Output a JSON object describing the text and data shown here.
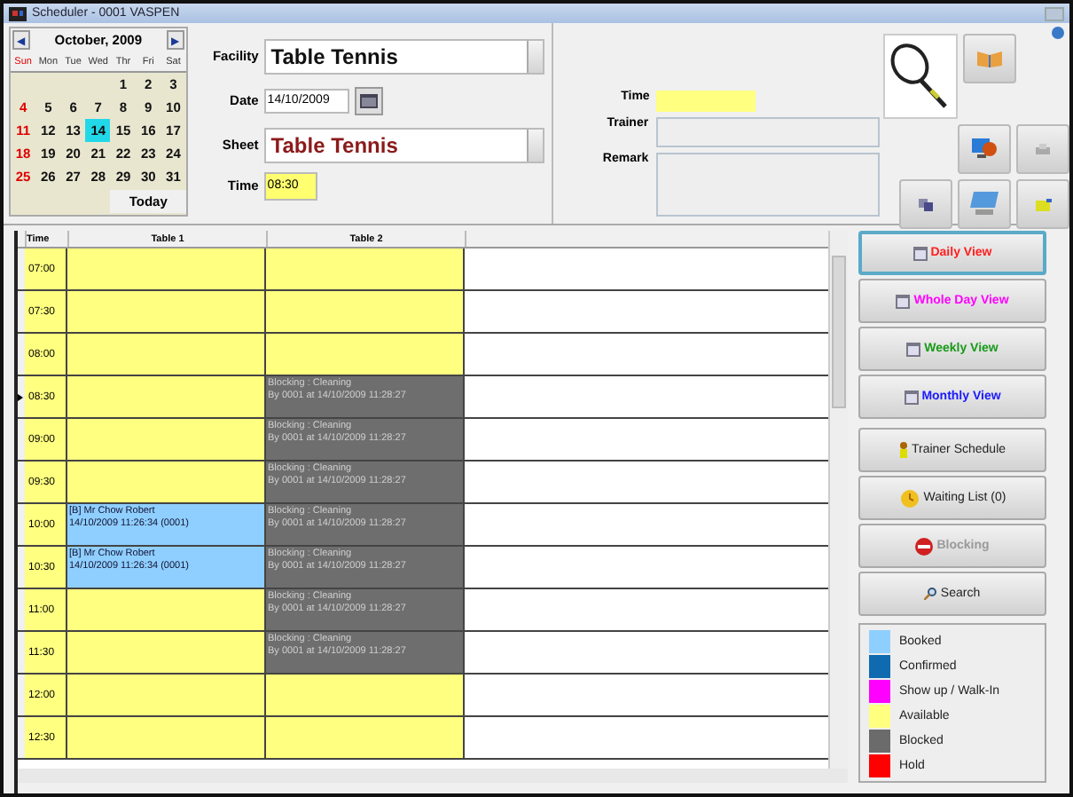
{
  "window": {
    "title": "Scheduler - 0001 VASPEN"
  },
  "calendar": {
    "month": "October, 2009",
    "prev": "◀",
    "next": "▶",
    "weekdays": [
      "Sun",
      "Mon",
      "Tue",
      "Wed",
      "Thr",
      "Fri",
      "Sat"
    ],
    "weeks": [
      [
        {
          "kind": "blank"
        },
        {
          "kind": "blank"
        },
        {
          "kind": "blank"
        },
        {
          "kind": "blank"
        },
        {
          "kind": "day",
          "day": "1",
          "selected": false
        },
        {
          "kind": "day",
          "day": "2",
          "selected": false
        },
        {
          "kind": "day",
          "day": "3",
          "selected": false
        }
      ],
      [
        {
          "kind": "day",
          "day": "4",
          "selected": false
        },
        {
          "kind": "day",
          "day": "5",
          "selected": false
        },
        {
          "kind": "day",
          "day": "6",
          "selected": false
        },
        {
          "kind": "day",
          "day": "7",
          "selected": false
        },
        {
          "kind": "day",
          "day": "8",
          "selected": false
        },
        {
          "kind": "day",
          "day": "9",
          "selected": false
        },
        {
          "kind": "day",
          "day": "10",
          "selected": false
        }
      ],
      [
        {
          "kind": "day",
          "day": "11",
          "selected": false
        },
        {
          "kind": "day",
          "day": "12",
          "selected": false
        },
        {
          "kind": "day",
          "day": "13",
          "selected": false
        },
        {
          "kind": "day",
          "day": "14",
          "selected": true
        },
        {
          "kind": "day",
          "day": "15",
          "selected": false
        },
        {
          "kind": "day",
          "day": "16",
          "selected": false
        },
        {
          "kind": "day",
          "day": "17",
          "selected": false
        }
      ],
      [
        {
          "kind": "day",
          "day": "18",
          "selected": false
        },
        {
          "kind": "day",
          "day": "19",
          "selected": false
        },
        {
          "kind": "day",
          "day": "20",
          "selected": false
        },
        {
          "kind": "day",
          "day": "21",
          "selected": false
        },
        {
          "kind": "day",
          "day": "22",
          "selected": false
        },
        {
          "kind": "day",
          "day": "23",
          "selected": false
        },
        {
          "kind": "day",
          "day": "24",
          "selected": false
        }
      ],
      [
        {
          "kind": "day",
          "day": "25",
          "selected": false
        },
        {
          "kind": "day",
          "day": "26",
          "selected": false
        },
        {
          "kind": "day",
          "day": "27",
          "selected": false
        },
        {
          "kind": "day",
          "day": "28",
          "selected": false
        },
        {
          "kind": "day",
          "day": "29",
          "selected": false
        },
        {
          "kind": "day",
          "day": "30",
          "selected": false
        },
        {
          "kind": "day",
          "day": "31",
          "selected": false
        }
      ]
    ],
    "today": "Today"
  },
  "form": {
    "facility_label": "Facility",
    "facility": "Table Tennis",
    "date_label": "Date",
    "date": "14/10/2009",
    "sheet_label": "Sheet",
    "sheet": "Table Tennis",
    "time_label": "Time",
    "time": "08:30"
  },
  "details": {
    "time_label": "Time",
    "trainer_label": "Trainer",
    "remark_label": "Remark"
  },
  "grid": {
    "columns": [
      "Time",
      "Table 1",
      "Table 2"
    ],
    "rows": [
      {
        "current": false,
        "cells": [
          {
            "kind": "time",
            "text": "07:00"
          },
          {
            "kind": "available"
          },
          {
            "kind": "available"
          }
        ]
      },
      {
        "current": false,
        "cells": [
          {
            "kind": "time",
            "text": "07:30"
          },
          {
            "kind": "available"
          },
          {
            "kind": "available"
          }
        ]
      },
      {
        "current": false,
        "cells": [
          {
            "kind": "time",
            "text": "08:00"
          },
          {
            "kind": "available"
          },
          {
            "kind": "available"
          }
        ]
      },
      {
        "current": true,
        "cells": [
          {
            "kind": "time",
            "text": "08:30"
          },
          {
            "kind": "available"
          },
          {
            "kind": "blocked",
            "lines": [
              "Blocking : Cleaning",
              "By 0001 at 14/10/2009 11:28:27"
            ]
          }
        ]
      },
      {
        "current": false,
        "cells": [
          {
            "kind": "time",
            "text": "09:00"
          },
          {
            "kind": "available"
          },
          {
            "kind": "blocked",
            "lines": [
              "Blocking : Cleaning",
              "By 0001 at 14/10/2009 11:28:27"
            ]
          }
        ]
      },
      {
        "current": false,
        "cells": [
          {
            "kind": "time",
            "text": "09:30"
          },
          {
            "kind": "available"
          },
          {
            "kind": "blocked",
            "lines": [
              "Blocking : Cleaning",
              "By 0001 at 14/10/2009 11:28:27"
            ]
          }
        ]
      },
      {
        "current": false,
        "cells": [
          {
            "kind": "time",
            "text": "10:00"
          },
          {
            "kind": "booked",
            "lines": [
              "[B] Mr Chow Robert",
              "14/10/2009 11:26:34 (0001)"
            ]
          },
          {
            "kind": "blocked",
            "lines": [
              "Blocking : Cleaning",
              "By 0001 at 14/10/2009 11:28:27"
            ]
          }
        ]
      },
      {
        "current": false,
        "cells": [
          {
            "kind": "time",
            "text": "10:30"
          },
          {
            "kind": "booked",
            "lines": [
              "[B] Mr Chow Robert",
              "14/10/2009 11:26:34 (0001)"
            ]
          },
          {
            "kind": "blocked",
            "lines": [
              "Blocking : Cleaning",
              "By 0001 at 14/10/2009 11:28:27"
            ]
          }
        ]
      },
      {
        "current": false,
        "cells": [
          {
            "kind": "time",
            "text": "11:00"
          },
          {
            "kind": "available"
          },
          {
            "kind": "blocked",
            "lines": [
              "Blocking : Cleaning",
              "By 0001 at 14/10/2009 11:28:27"
            ]
          }
        ]
      },
      {
        "current": false,
        "cells": [
          {
            "kind": "time",
            "text": "11:30"
          },
          {
            "kind": "available"
          },
          {
            "kind": "blocked",
            "lines": [
              "Blocking : Cleaning",
              "By 0001 at 14/10/2009 11:28:27"
            ]
          }
        ]
      },
      {
        "current": false,
        "cells": [
          {
            "kind": "time",
            "text": "12:00"
          },
          {
            "kind": "available"
          },
          {
            "kind": "available"
          }
        ]
      },
      {
        "current": false,
        "cells": [
          {
            "kind": "time",
            "text": "12:30"
          },
          {
            "kind": "available"
          },
          {
            "kind": "available"
          }
        ]
      }
    ]
  },
  "actions": [
    {
      "label": "Daily View",
      "kind": "view",
      "color": "#ff2020",
      "selected": true,
      "disabled": false
    },
    {
      "label": "Whole Day View",
      "kind": "view",
      "color": "#ff00ff",
      "selected": false,
      "disabled": false
    },
    {
      "label": "Weekly View",
      "kind": "view",
      "color": "#1a9a1a",
      "selected": false,
      "disabled": false
    },
    {
      "label": "Monthly View",
      "kind": "view",
      "color": "#1a1aff",
      "selected": false,
      "disabled": false
    },
    {
      "label": "Trainer Schedule",
      "kind": "trainer",
      "selected": false,
      "disabled": false
    },
    {
      "label": "Waiting List (0)",
      "kind": "waiting",
      "selected": false,
      "disabled": false
    },
    {
      "label": "Blocking",
      "kind": "blocking",
      "selected": false,
      "disabled": true
    },
    {
      "label": "Search",
      "kind": "search",
      "selected": false,
      "disabled": false
    }
  ],
  "legend": [
    {
      "label": "Booked",
      "color": "#8fcfff"
    },
    {
      "label": "Confirmed",
      "color": "#106ab0"
    },
    {
      "label": "Show up / Walk-In",
      "color": "#ff00ff"
    },
    {
      "label": "Available",
      "color": "#ffff80"
    },
    {
      "label": "Blocked",
      "color": "#6b6b6b"
    },
    {
      "label": "Hold",
      "color": "#ff0000"
    }
  ]
}
